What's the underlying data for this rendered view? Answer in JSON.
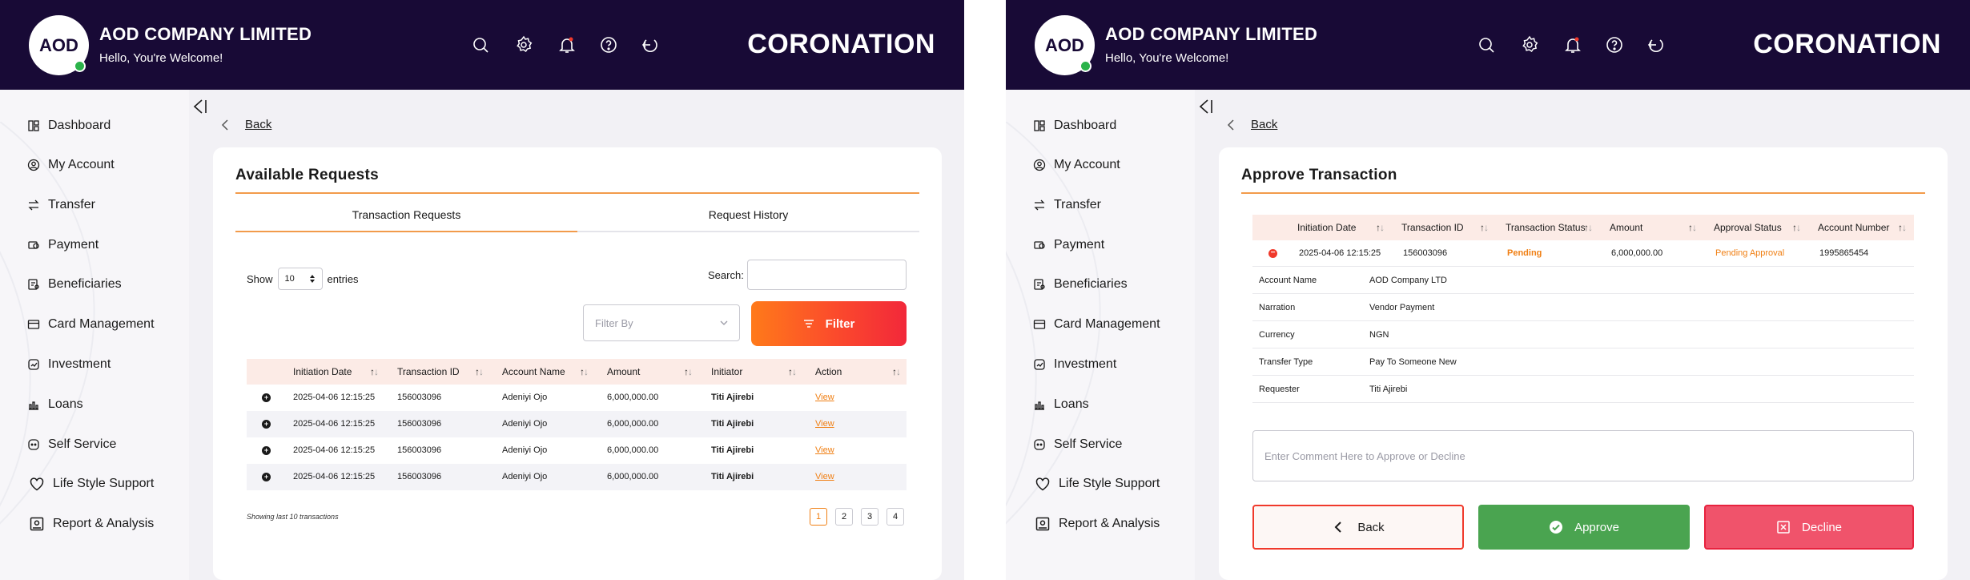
{
  "header": {
    "avatar_initials": "AOD",
    "company_name": "AOD COMPANY LIMITED",
    "welcome": "Hello, You're Welcome!",
    "brand": "CORONATION",
    "icons": [
      "search-icon",
      "settings-icon",
      "notification-bell-icon",
      "help-icon",
      "logout-icon"
    ],
    "colors": {
      "header_bg": "#180a36",
      "accent": "#f07f13",
      "online_dot": "#2bb34a"
    }
  },
  "sidebar": {
    "items": [
      {
        "label": "Dashboard",
        "icon": "dashboard-icon"
      },
      {
        "label": "My Account",
        "icon": "account-icon"
      },
      {
        "label": "Transfer",
        "icon": "transfer-icon"
      },
      {
        "label": "Payment",
        "icon": "payment-icon"
      },
      {
        "label": "Beneficiaries",
        "icon": "beneficiaries-icon"
      },
      {
        "label": "Card Management",
        "icon": "card-icon"
      },
      {
        "label": "Investment",
        "icon": "investment-icon"
      },
      {
        "label": "Loans",
        "icon": "loans-icon"
      },
      {
        "label": "Self Service",
        "icon": "self-service-icon"
      },
      {
        "label": "Life Style Support",
        "icon": "heart-icon"
      },
      {
        "label": "Report & Analysis",
        "icon": "report-icon"
      }
    ]
  },
  "back_label": "Back",
  "requests": {
    "title": "Available Requests",
    "tabs": [
      {
        "label": "Transaction Requests",
        "active": true
      },
      {
        "label": "Request History",
        "active": false
      }
    ],
    "show_label": "Show",
    "entries_value": "10",
    "entries_label": "entries",
    "search_label": "Search:",
    "search_value": "",
    "filter_placeholder": "Filter By",
    "filter_button": "Filter",
    "columns": [
      "Initiation Date",
      "Transaction ID",
      "Account Name",
      "Amount",
      "Initiator",
      "Action"
    ],
    "rows": [
      {
        "date": "2025-04-06 12:15:25",
        "id": "156003096",
        "account": "Adeniyi Ojo",
        "amount": "6,000,000.00",
        "initiator": "Titi Ajirebi",
        "action": "View"
      },
      {
        "date": "2025-04-06 12:15:25",
        "id": "156003096",
        "account": "Adeniyi Ojo",
        "amount": "6,000,000.00",
        "initiator": "Titi Ajirebi",
        "action": "View"
      },
      {
        "date": "2025-04-06 12:15:25",
        "id": "156003096",
        "account": "Adeniyi Ojo",
        "amount": "6,000,000.00",
        "initiator": "Titi Ajirebi",
        "action": "View"
      },
      {
        "date": "2025-04-06 12:15:25",
        "id": "156003096",
        "account": "Adeniyi Ojo",
        "amount": "6,000,000.00",
        "initiator": "Titi Ajirebi",
        "action": "View"
      }
    ],
    "footer_note": "Showing last 10 transactions",
    "pages": [
      "1",
      "2",
      "3",
      "4"
    ],
    "active_page": "1"
  },
  "approve": {
    "title": "Approve Transaction",
    "columns": [
      "Initiation Date",
      "Transaction ID",
      "Transaction Status",
      "Amount",
      "Approval Status",
      "Account Number"
    ],
    "row": {
      "date": "2025-04-06 12:15:25",
      "id": "156003096",
      "status": "Pending",
      "amount": "6,000,000.00",
      "approval_status": "Pending Approval",
      "account_number": "1995865454"
    },
    "details": [
      {
        "label": "Account Name",
        "value": "AOD Company LTD"
      },
      {
        "label": "Narration",
        "value": "Vendor Payment"
      },
      {
        "label": "Currency",
        "value": "NGN"
      },
      {
        "label": "Transfer Type",
        "value": "Pay To Someone New"
      },
      {
        "label": "Requester",
        "value": "Titi Ajirebi"
      }
    ],
    "comment_placeholder": "Enter Comment Here to Approve or Decline",
    "buttons": {
      "back": "Back",
      "approve": "Approve",
      "decline": "Decline"
    },
    "colors": {
      "approve": "#4aa450",
      "decline": "#f0536b",
      "back_border": "#f07f13"
    }
  }
}
